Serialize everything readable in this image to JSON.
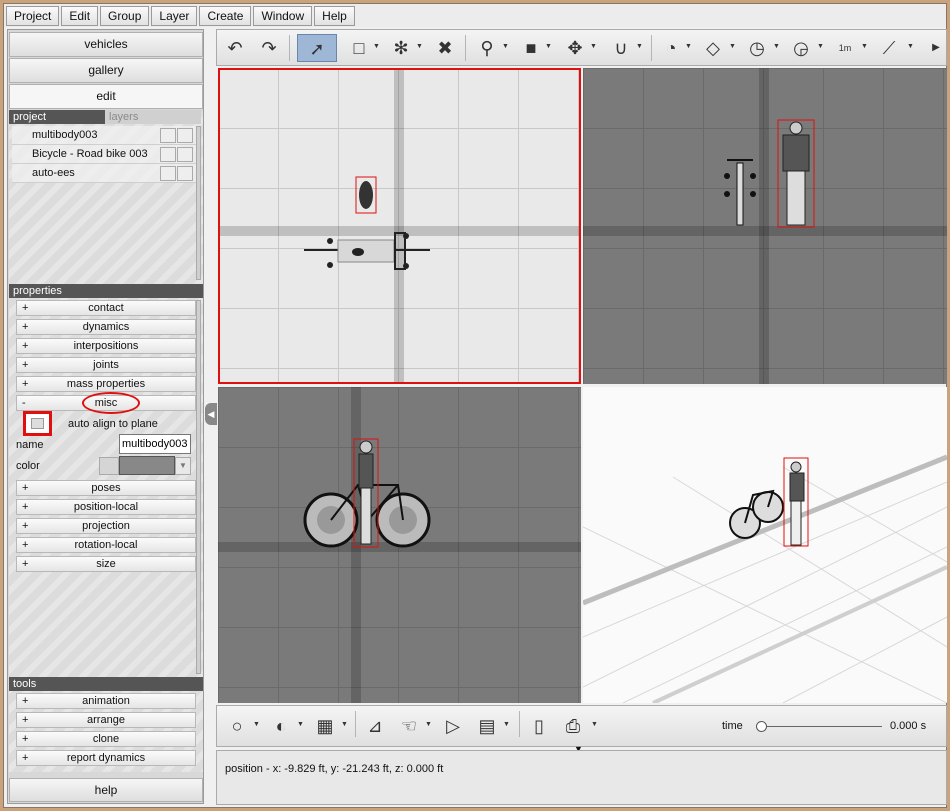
{
  "menubar": [
    "Project",
    "Edit",
    "Group",
    "Layer",
    "Create",
    "Window",
    "Help"
  ],
  "left_panel": {
    "nav": [
      "vehicles",
      "gallery",
      "edit"
    ],
    "tabs": {
      "project": "project",
      "layers": "layers"
    },
    "project_items": [
      "multibody003",
      "Bicycle - Road bike 003",
      "auto-ees"
    ],
    "properties_header": "properties",
    "properties": [
      {
        "sign": "+",
        "label": "contact"
      },
      {
        "sign": "+",
        "label": "dynamics"
      },
      {
        "sign": "+",
        "label": "interpositions"
      },
      {
        "sign": "+",
        "label": "joints"
      },
      {
        "sign": "+",
        "label": "mass properties"
      },
      {
        "sign": "-",
        "label": "misc"
      }
    ],
    "misc": {
      "auto_align_label": "auto align to plane",
      "auto_align_checked": false,
      "name_label": "name",
      "name_value": "multibody003",
      "color_label": "color",
      "color_value": "#888888"
    },
    "properties_more": [
      {
        "sign": "+",
        "label": "poses"
      },
      {
        "sign": "+",
        "label": "position-local"
      },
      {
        "sign": "+",
        "label": "projection"
      },
      {
        "sign": "+",
        "label": "rotation-local"
      },
      {
        "sign": "+",
        "label": "size"
      }
    ],
    "tools_header": "tools",
    "tools": [
      {
        "sign": "+",
        "label": "animation"
      },
      {
        "sign": "+",
        "label": "arrange"
      },
      {
        "sign": "+",
        "label": "clone"
      },
      {
        "sign": "+",
        "label": "report dynamics"
      }
    ],
    "help": "help"
  },
  "toolbar": {
    "icons": [
      "undo-icon",
      "redo-icon",
      "select-arrow-icon",
      "select-rect-icon",
      "join-icon",
      "delete-icon",
      "zoom-icon",
      "box-icon",
      "move-icon",
      "magnet-icon",
      "rotate-icon",
      "plane-icon",
      "angle-icon",
      "dial-icon",
      "measure-icon",
      "tape-icon"
    ],
    "measure_text": "1m"
  },
  "bottom_toolbar": {
    "time_label": "time",
    "time_value": "0.000 s",
    "time_progress": 0
  },
  "status": {
    "position_text": "position - x: -9.829 ft, y: -21.243 ft, z: 0.000 ft"
  }
}
